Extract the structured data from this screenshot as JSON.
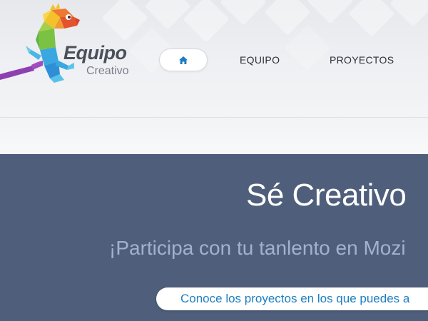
{
  "header": {
    "logo": {
      "name": "Equipo",
      "subtitle": "Creativo"
    },
    "nav": {
      "home_icon": "home-icon",
      "items": [
        {
          "label": "EQUIPO"
        },
        {
          "label": "PROYECTOS"
        }
      ]
    }
  },
  "hero": {
    "title": "Sé Creativo",
    "subtitle": "¡Participa con tu tanlento en Mozi",
    "cta_label": "Conoce los proyectos en los que puedes a"
  },
  "colors": {
    "hero_background": "#4f5f7b",
    "cta_text": "#1c7fc0",
    "home_icon": "#1f7bc1"
  }
}
